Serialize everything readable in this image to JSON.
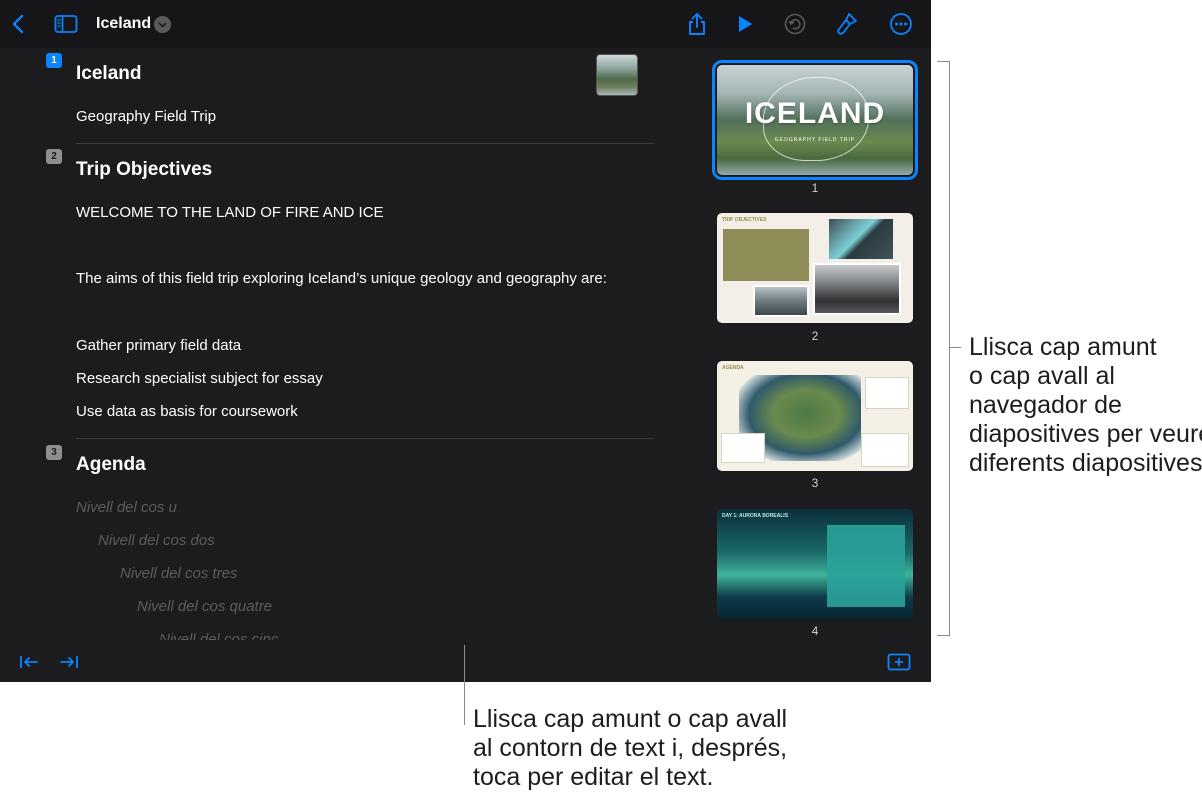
{
  "toolbar": {
    "back_icon": "chevron-left-icon",
    "sidebar_icon": "sidebar-icon",
    "title": "Iceland",
    "title_menu_icon": "chevron-down-icon",
    "share_icon": "share-icon",
    "play_icon": "play-icon",
    "undo_icon": "undo-icon",
    "format_icon": "paintbrush-icon",
    "more_icon": "ellipsis-icon",
    "accent_color": "#0a84ff"
  },
  "outline": {
    "slides": [
      {
        "number": "1",
        "title": "Iceland",
        "lines": [
          "Geography Field Trip"
        ]
      },
      {
        "number": "2",
        "title": "Trip Objectives",
        "lines": [
          "WELCOME TO THE LAND OF FIRE AND ICE",
          "The aims of this field trip exploring Iceland’s unique geology and geography are:",
          "Gather primary field data",
          "Research specialist subject for essay",
          "Use data as basis for coursework"
        ]
      },
      {
        "number": "3",
        "title": "Agenda",
        "placeholders": [
          "Nivell del cos u",
          "Nivell del cos dos",
          "Nivell del cos tres",
          "Nivell del cos quatre",
          "Nivell del cos cinc"
        ]
      }
    ]
  },
  "bottombar": {
    "outdent_icon": "outdent-icon",
    "indent_icon": "indent-icon",
    "add_slide_icon": "add-slide-icon"
  },
  "navigator": {
    "thumbnails": [
      {
        "number": "1",
        "heading": "ICELAND",
        "subheading": "GEOGRAPHY FIELD TRIP",
        "selected": true
      },
      {
        "number": "2",
        "heading": "TRIP OBJECTIVES"
      },
      {
        "number": "3",
        "heading": "AGENDA"
      },
      {
        "number": "4",
        "heading": "DAY 1: AURORA BOREALIS"
      }
    ]
  },
  "callouts": {
    "navigator_lines": [
      "Llisca cap amunt",
      "o cap avall al",
      "navegador de",
      "diapositives per veure",
      "diferents diapositives."
    ],
    "outline_lines": [
      "Llisca cap amunt o cap avall",
      "al contorn de text i, després,",
      "toca per editar el text."
    ]
  }
}
